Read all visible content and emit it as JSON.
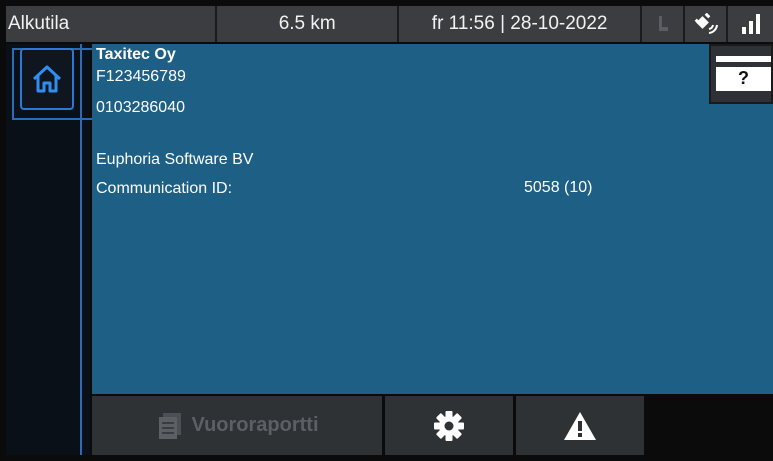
{
  "status_bar": {
    "state": "Alkutila",
    "distance": "6.5 km",
    "datetime": "fr 11:56 | 28-10-2022",
    "icons": [
      "seat-icon",
      "gps-icon",
      "signal-icon"
    ]
  },
  "info": {
    "company": "Taxitec Oy",
    "id1": "F123456789",
    "id2": "0103286040",
    "vendor": "Euphoria Software BV",
    "comm_label": "Communication ID:",
    "comm_value": "5058 (10)"
  },
  "card_button": {
    "label": "?"
  },
  "bottom": {
    "report_label": "Vuororaportti",
    "report_icon": "document-stack-icon",
    "settings_icon": "gear-icon",
    "alert_icon": "warning-icon"
  },
  "colors": {
    "panel": "#1d5f85",
    "accent": "#2a78d8",
    "bar": "#3b3d40"
  }
}
